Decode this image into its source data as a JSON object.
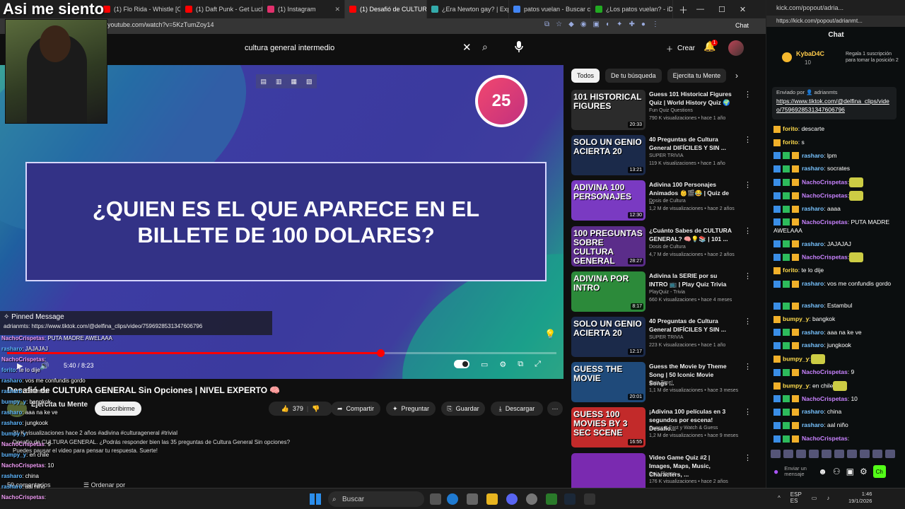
{
  "overlay": {
    "caption": "Asi me siento"
  },
  "browser": {
    "tabs": [
      {
        "label": "(1) Flo Rida - Whistle [O",
        "color": "#ff0000"
      },
      {
        "label": "(1) Daft Punk - Get Luck",
        "color": "#ff0000"
      },
      {
        "label": "(1) Instagram",
        "color": "#e1306c"
      },
      {
        "label": "(1) Desafió de CULTURA",
        "color": "#ff0000",
        "active": true
      },
      {
        "label": "¿Era Newton gay? | Exp",
        "color": "#3aa"
      },
      {
        "label": "patos vuelan - Buscar co",
        "color": "#4285f4"
      },
      {
        "label": "¿Los patos vuelan? - iD",
        "color": "#2a2"
      }
    ],
    "url": "youtube.com/watch?v=5KzTumZoy14",
    "chat_button": "Chat"
  },
  "youtube": {
    "search_value": "cultura general intermedio",
    "create_label": "Crear",
    "notif_count": "1",
    "video": {
      "question": "¿QUIEN ES EL QUE APARECE EN EL BILLETE DE 100 DOLARES?",
      "timer": "25",
      "time": "5:40 / 8:23",
      "progress_fraction": 0.68
    },
    "pinned": {
      "title": "Pinned Message",
      "message": "adrianmts: https://www.tiktok.com/@delfina_clips/video/7596928531347606796"
    },
    "title": "Desafió de CULTURA GENERAL Sin Opciones | NIVEL EXPERTO 🧠",
    "channel": "Ejercita tu Mente",
    "subscribe": "Suscribirme",
    "likes": "379",
    "actions": {
      "share": "Compartir",
      "ask": "Preguntar",
      "save": "Guardar",
      "download": "Descargar"
    },
    "desc_meta": "31 K visualizaciones  hace 2 años  #adivina #culturageneral #trivial",
    "desc1": "Desafío de CULTURA GENERAL. ¿Podrás responder bien las 35 preguntas de Cultura General Sin opciones?",
    "desc2": "Puedes pausar el video para pensar tu respuesta. Suerte!",
    "comments": "59 comentarios",
    "order": "Ordenar por",
    "chips": [
      "Todos",
      "De tu búsqueda",
      "Ejercita tu Mente"
    ],
    "recs": [
      {
        "thumb": "101 HISTORICAL FIGURES",
        "bg": "#2b2b2b",
        "dur": "20:33",
        "title": "Guess 101 Historical Figures Quiz | World History Quiz 🌍",
        "channel": "Fun Quiz Questions",
        "meta": "790 K visualizaciones • hace 1 año"
      },
      {
        "thumb": "SOLO UN GENIO ACIERTA 20",
        "bg": "#1b2a4a",
        "dur": "13:21",
        "title": "40 Preguntas de Cultura General DIFÍCILES Y SIN ...",
        "channel": "SUPER TRIVIA",
        "meta": "119 K visualizaciones • hace 1 año"
      },
      {
        "thumb": "ADIVINA 100 PERSONAJES",
        "bg": "#7a3ac2",
        "dur": "12:30",
        "title": "Adivina 100 Personajes Animados 👶🎬😂 | Quiz de ...",
        "channel": "Dosis de Cultura",
        "meta": "1,2 M de visualizaciones • hace 2 años"
      },
      {
        "thumb": "100 PREGUNTAS SOBRE CULTURA GENERAL",
        "bg": "#5b2d8a",
        "dur": "28:27",
        "title": "¿Cuánto Sabes de CULTURA GENERAL? 🧠💡📚 | 101 ...",
        "channel": "Dosis de Cultura",
        "meta": "4,7 M de visualizaciones • hace 2 años"
      },
      {
        "thumb": "ADIVINA POR INTRO",
        "bg": "#2c8a3a",
        "dur": "8:17",
        "title": "Adivina la SERIE por su INTRO 📺 | Play Quiz Trivia",
        "channel": "PlayQuiz - Trivia",
        "meta": "660 K visualizaciones • hace 4 meses"
      },
      {
        "thumb": "SOLO UN GENIO ACIERTA 20",
        "bg": "#1b2a4a",
        "dur": "12:17",
        "title": "40 Preguntas de Cultura General DIFÍCILES Y SIN ...",
        "channel": "SUPER TRIVIA",
        "meta": "223 K visualizaciones • hace 1 año"
      },
      {
        "thumb": "GUESS THE MOVIE",
        "bg": "#1f4a7a",
        "dur": "20:01",
        "title": "Guess the Movie by Theme Song | 50 Iconic Movie Songs ...",
        "channel": "Quiz Time!",
        "meta": "1,1 M de visualizaciones • hace 3 meses"
      },
      {
        "thumb": "GUESS 100 MOVIES BY 3 SEC SCENE",
        "bg": "#c22a2a",
        "dur": "16:55",
        "title": "¡Adivina 100 películas en 3 segundos por escena! Desafío...",
        "channel": "Guess It Fast y Watch & Guess",
        "meta": "1,2 M de visualizaciones • hace 9 meses"
      },
      {
        "thumb": "",
        "bg": "#7a2ab0",
        "dur": "",
        "title": "Video Game Quiz #2 | Images, Maps, Music, Characters, ...",
        "channel": "Quiz Please",
        "meta": "176 K visualizaciones • hace 2 años"
      }
    ]
  },
  "left_chat": [
    {
      "u": "NachoCrispetas",
      "m": ": PUTA MADRE AWELAAA",
      "g": true
    },
    {
      "u": "rasharo",
      "m": ": JAJAJAJ"
    },
    {
      "u": "NachoCrispetas",
      "m": ":",
      "g": true
    },
    {
      "u": "forito",
      "m": ": te lo dije"
    },
    {
      "u": "rasharo",
      "m": ": vos me confundis gordo"
    },
    {
      "u": "rasharo",
      "m": ": Estambul"
    },
    {
      "u": "bumpy_y",
      "m": ": bangkok"
    },
    {
      "u": "rasharo",
      "m": ": aaa na ke ve"
    },
    {
      "u": "rasharo",
      "m": ": jungkook"
    },
    {
      "u": "bumpy_y",
      "m": ":"
    },
    {
      "u": "NachoCrispetas",
      "m": ": 9",
      "g": true
    },
    {
      "u": "bumpy_y",
      "m": ": en chile"
    },
    {
      "u": "NachoCrispetas",
      "m": ": 10",
      "g": true
    },
    {
      "u": "rasharo",
      "m": ": china"
    },
    {
      "u": "rasharo",
      "m": ": aal niño"
    },
    {
      "u": "NachoCrispetas",
      "m": ":",
      "g": true
    }
  ],
  "kick": {
    "tab": "kick.com/popout/adria...",
    "url": "https://kick.com/popout/adrianmt...",
    "header": "Chat",
    "sub_user": "KybaD4C",
    "sub_count": "10",
    "sub_text": "Regala 1 suscripción para tomar la posición 2",
    "pinned_by": "Enviado por 👤 adrianmts",
    "pinned_link": "https://www.tiktok.com/@delfina_clips/video/7596928531347606796",
    "messages": [
      {
        "u": "forito",
        "m": ": descarte",
        "c": "y",
        "b": 1
      },
      {
        "u": "forito",
        "m": ": s",
        "c": "y",
        "b": 1
      },
      {
        "u": "rasharo",
        "m": ": lpm",
        "c": "b",
        "b": 3
      },
      {
        "u": "rasharo",
        "m": ": socrates",
        "c": "b",
        "b": 3
      },
      {
        "u": "NachoCrispetas",
        "m": ":",
        "c": "p",
        "b": 3,
        "e": true
      },
      {
        "u": "NachoCrispetas",
        "m": ":",
        "c": "p",
        "b": 3,
        "e": true
      },
      {
        "u": "rasharo",
        "m": ": aaaa",
        "c": "b",
        "b": 3
      },
      {
        "u": "NachoCrispetas",
        "m": ": PUTA MADRE AWELAAA",
        "c": "p",
        "b": 3
      },
      {
        "u": "rasharo",
        "m": ": JAJAJAJ",
        "c": "b",
        "b": 3
      },
      {
        "u": "NachoCrispetas",
        "m": ":",
        "c": "p",
        "b": 3,
        "e": true
      },
      {
        "u": "forito",
        "m": ": te lo dije",
        "c": "y",
        "b": 1
      },
      {
        "u": "rasharo",
        "m": ": vos me confundis gordo",
        "c": "b",
        "b": 3
      },
      {
        "u": "rasharo",
        "m": ": Estambul",
        "c": "b",
        "b": 3
      },
      {
        "u": "bumpy_y",
        "m": ": bangkok",
        "c": "y",
        "b": 1
      },
      {
        "u": "rasharo",
        "m": ": aaa na ke ve",
        "c": "b",
        "b": 3
      },
      {
        "u": "rasharo",
        "m": ": jungkook",
        "c": "b",
        "b": 3
      },
      {
        "u": "bumpy_y",
        "m": ":",
        "c": "y",
        "b": 1,
        "e": true
      },
      {
        "u": "NachoCrispetas",
        "m": ": 9",
        "c": "p",
        "b": 3
      },
      {
        "u": "bumpy_y",
        "m": ": en chile",
        "c": "y",
        "b": 1,
        "e": true
      },
      {
        "u": "NachoCrispetas",
        "m": ": 10",
        "c": "p",
        "b": 3
      },
      {
        "u": "rasharo",
        "m": ": china",
        "c": "b",
        "b": 3
      },
      {
        "u": "rasharo",
        "m": ": aal niño",
        "c": "b",
        "b": 3
      },
      {
        "u": "NachoCrispetas",
        "m": ":",
        "c": "p",
        "b": 3
      }
    ],
    "input_placeholder": "Enviar un mensaje",
    "send": "Ch"
  },
  "taskbar": {
    "search": "Buscar",
    "lang": "ESP\nES",
    "time": "1:46",
    "date": "19/1/2026"
  }
}
